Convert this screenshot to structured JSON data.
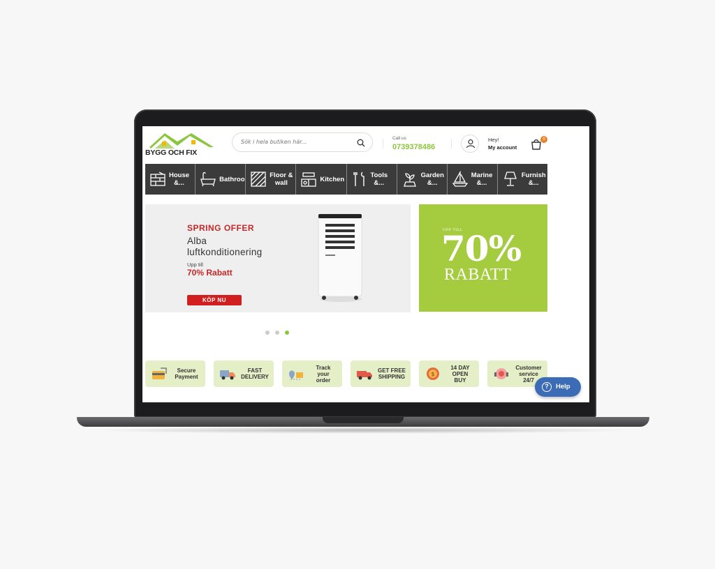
{
  "brand": {
    "logo_text": "BYGG OCH FIX",
    "accent_green": "#8cc63f",
    "dark_nav": "#3b3b3b",
    "offer_red": "#c62828"
  },
  "header": {
    "search_placeholder": "Sök i hela butiken här...",
    "call_label": "Call us",
    "phone": "0739378486",
    "greeting": "Hey!",
    "account_label": "My account",
    "cart_count": "0"
  },
  "nav": {
    "items": [
      {
        "label": "House\n&...",
        "icon": "brick-wall-icon"
      },
      {
        "label": "Bathroo",
        "icon": "bathtub-icon"
      },
      {
        "label": "Floor &\nwall",
        "icon": "floor-tiles-icon"
      },
      {
        "label": "Kitchen",
        "icon": "kitchen-icon"
      },
      {
        "label": "Tools\n&...",
        "icon": "tools-icon"
      },
      {
        "label": "Garden\n&...",
        "icon": "garden-icon"
      },
      {
        "label": "Marine\n&...",
        "icon": "sailboat-icon"
      },
      {
        "label": "Furnish\n&...",
        "icon": "lamp-icon"
      }
    ]
  },
  "banner": {
    "tag": "SPRING OFFER",
    "product_line1": "Alba",
    "product_line2": "luftkonditionering",
    "upp_till": "Upp till",
    "discount": "70% Rabatt",
    "cta": "KÖP NU"
  },
  "promo": {
    "upp_till": "UPP TILL",
    "percent": "70%",
    "word": "RABATT"
  },
  "slider": {
    "active_index": 2,
    "count": 3
  },
  "features": [
    {
      "label": "Secure\nPayment",
      "icon": "secure-payment-icon"
    },
    {
      "label": "FAST\nDELIVERY",
      "icon": "delivery-truck-icon"
    },
    {
      "label": "Track\nyour\norder",
      "icon": "track-order-icon"
    },
    {
      "label": "GET FREE\nSHIPPING",
      "icon": "free-shipping-icon"
    },
    {
      "label": "14 DAY\nOPEN\nBUY",
      "icon": "open-buy-icon"
    },
    {
      "label": "Customer\nservice\n24/7",
      "icon": "customer-service-icon"
    }
  ],
  "help": {
    "label": "Help"
  }
}
